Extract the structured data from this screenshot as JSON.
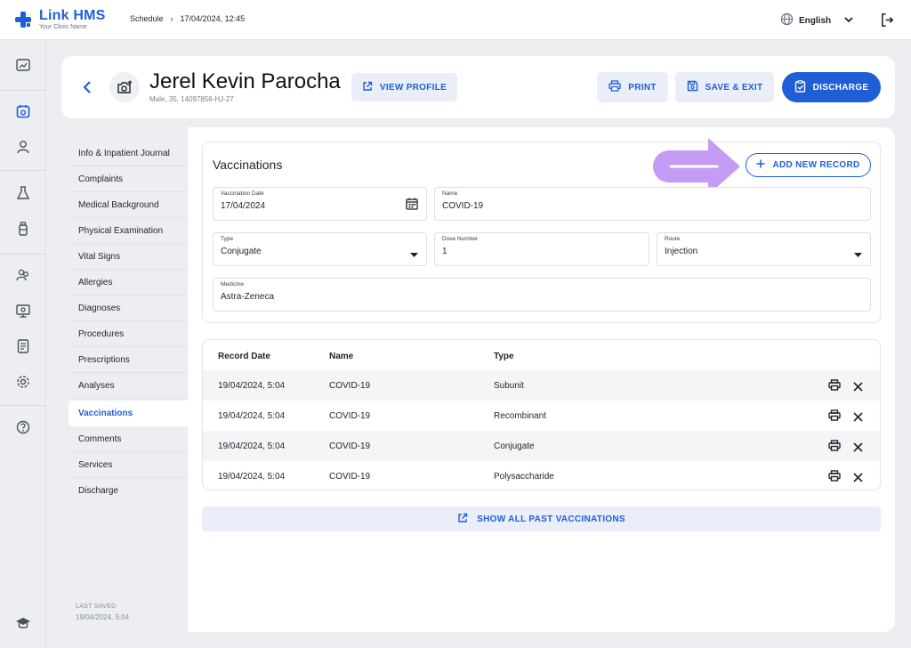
{
  "app": {
    "name": "Link HMS",
    "subtitle": "Your Clinic Name",
    "brand_color": "#1f5fd6"
  },
  "breadcrumb": {
    "items": [
      "Schedule",
      "17/04/2024, 12:45"
    ],
    "separator": "›"
  },
  "topbar": {
    "language": "English",
    "icons": [
      "globe-icon",
      "chevron-down-icon",
      "logout-icon"
    ]
  },
  "rail": {
    "icons": [
      "chart-icon",
      "calendar-icon",
      "user-icon",
      "flask-icon",
      "bottle-icon",
      "group-icon",
      "monitor-icon",
      "document-icon",
      "settings-icon",
      "help-icon",
      "graduation-cap-icon"
    ],
    "active": "calendar-icon"
  },
  "patient": {
    "name": "Jerel Kevin Parocha",
    "meta": "Male, 35, 14097856-HJ-27"
  },
  "header_buttons": {
    "view_profile": "VIEW PROFILE",
    "print": "PRINT",
    "save_exit": "SAVE & EXIT",
    "discharge": "DISCHARGE"
  },
  "subnav": {
    "items": [
      "Info & Inpatient Journal",
      "Complaints",
      "Medical Background",
      "Physical Examination",
      "Vital Signs",
      "Allergies",
      "Diagnoses",
      "Procedures",
      "Prescriptions",
      "Analyses",
      "Vaccinations",
      "Comments",
      "Services",
      "Discharge"
    ],
    "active": "Vaccinations",
    "last_saved_label": "LAST SAVED",
    "last_saved_value": "19/04/2024, 5:04"
  },
  "form": {
    "title": "Vaccinations",
    "add_button": "ADD NEW RECORD",
    "fields": {
      "vaccination_date": {
        "label": "Vaccination Date",
        "value": "17/04/2024"
      },
      "name": {
        "label": "Name",
        "value": "COVID-19"
      },
      "type": {
        "label": "Type",
        "value": "Conjugate"
      },
      "dose_number": {
        "label": "Dose Number",
        "value": "1"
      },
      "route": {
        "label": "Route",
        "value": "Injection"
      },
      "medicine": {
        "label": "Medicine",
        "value": "Astra-Zeneca"
      }
    }
  },
  "table": {
    "headers": [
      "Record Date",
      "Name",
      "Type"
    ],
    "rows": [
      {
        "date": "19/04/2024, 5:04",
        "name": "COVID-19",
        "type": "Subunit"
      },
      {
        "date": "19/04/2024, 5:04",
        "name": "COVID-19",
        "type": "Recombinant"
      },
      {
        "date": "19/04/2024, 5:04",
        "name": "COVID-19",
        "type": "Conjugate"
      },
      {
        "date": "19/04/2024, 5:04",
        "name": "COVID-19",
        "type": "Polysaccharide"
      }
    ]
  },
  "show_all": "SHOW ALL PAST VACCINATIONS",
  "highlight_arrow_color": "#c49bf5"
}
